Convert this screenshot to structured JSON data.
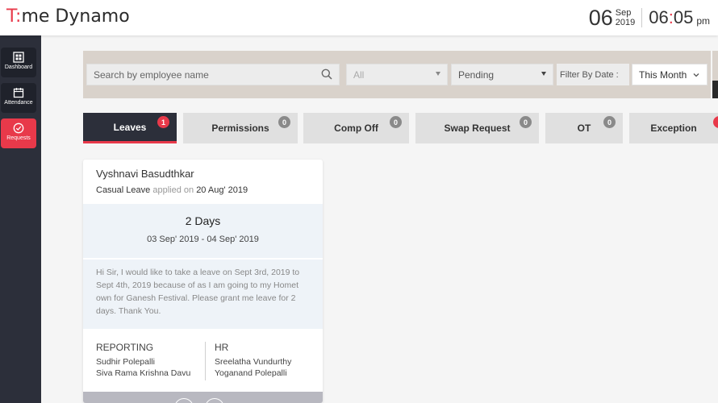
{
  "header": {
    "logo_text_1": "T",
    "logo_text_2": "me",
    "logo_text_3": " Dynamo",
    "date_day": "06",
    "date_month": "Sep",
    "date_year": "2019",
    "time_hour": "06",
    "time_colon": ":",
    "time_minute": "05",
    "time_ampm": "pm"
  },
  "sidebar": {
    "items": [
      {
        "label": "Dashboard"
      },
      {
        "label": "Attendance"
      },
      {
        "label": "Requests"
      }
    ]
  },
  "filters": {
    "search_placeholder": "Search by employee name",
    "all_value": "All",
    "status_value": "Pending",
    "filter_label": "Filter By Date :",
    "date_value": "This Month"
  },
  "tabs": [
    {
      "label": "Leaves",
      "count": "1"
    },
    {
      "label": "Permissions",
      "count": "0"
    },
    {
      "label": "Comp Off",
      "count": "0"
    },
    {
      "label": "Swap Request",
      "count": "0"
    },
    {
      "label": "OT",
      "count": "0"
    },
    {
      "label": "Exception",
      "count": ""
    }
  ],
  "card": {
    "name": "Vyshnavi Basudthkar",
    "leave_type": "Casual Leave",
    "applied_on": "applied on",
    "applied_date": "20 Aug' 2019",
    "days": "2 Days",
    "range": "03 Sep' 2019 - 04 Sep' 2019",
    "message": "Hi Sir, I would like to take a leave on Sept 3rd, 2019 to Sept 4th, 2019 because of as I am going to my Homet own for Ganesh Festival. Please grant me leave for 2 days. Thank You.",
    "reporting_title": "REPORTING",
    "reporting_1": "Sudhir Polepalli",
    "reporting_2": "Siva Rama Krishna Davu",
    "hr_title": "HR",
    "hr_1": "Sreelatha Vundurthy",
    "hr_2": "Yoganand Polepalli"
  },
  "colors": {
    "accent": "#e8394a",
    "sidebar": "#2c2f3a"
  }
}
